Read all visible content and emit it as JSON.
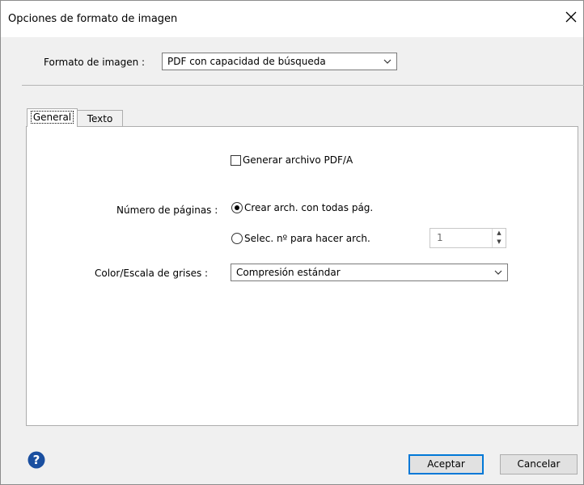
{
  "window": {
    "title": "Opciones de formato de imagen"
  },
  "format": {
    "label": "Formato de imagen :",
    "value": "PDF con capacidad de búsqueda"
  },
  "tabs": [
    {
      "label": "General",
      "active": true
    },
    {
      "label": "Texto",
      "active": false
    }
  ],
  "general": {
    "pdfa_checkbox": {
      "label": "Generar archivo PDF/A",
      "checked": false
    },
    "pages": {
      "label": "Número de páginas :",
      "option_all": {
        "label": "Crear arch. con todas pág.",
        "selected": true
      },
      "option_select": {
        "label": "Selec. nº para hacer arch.",
        "selected": false
      },
      "count_value": "1"
    },
    "color": {
      "label": "Color/Escala de grises :",
      "value": "Compresión estándar"
    }
  },
  "buttons": {
    "ok": "Aceptar",
    "cancel": "Cancelar"
  },
  "icons": {
    "help": "help-icon",
    "close": "close-icon"
  },
  "colors": {
    "accent": "#0078d7",
    "help": "#1a4fa0"
  }
}
